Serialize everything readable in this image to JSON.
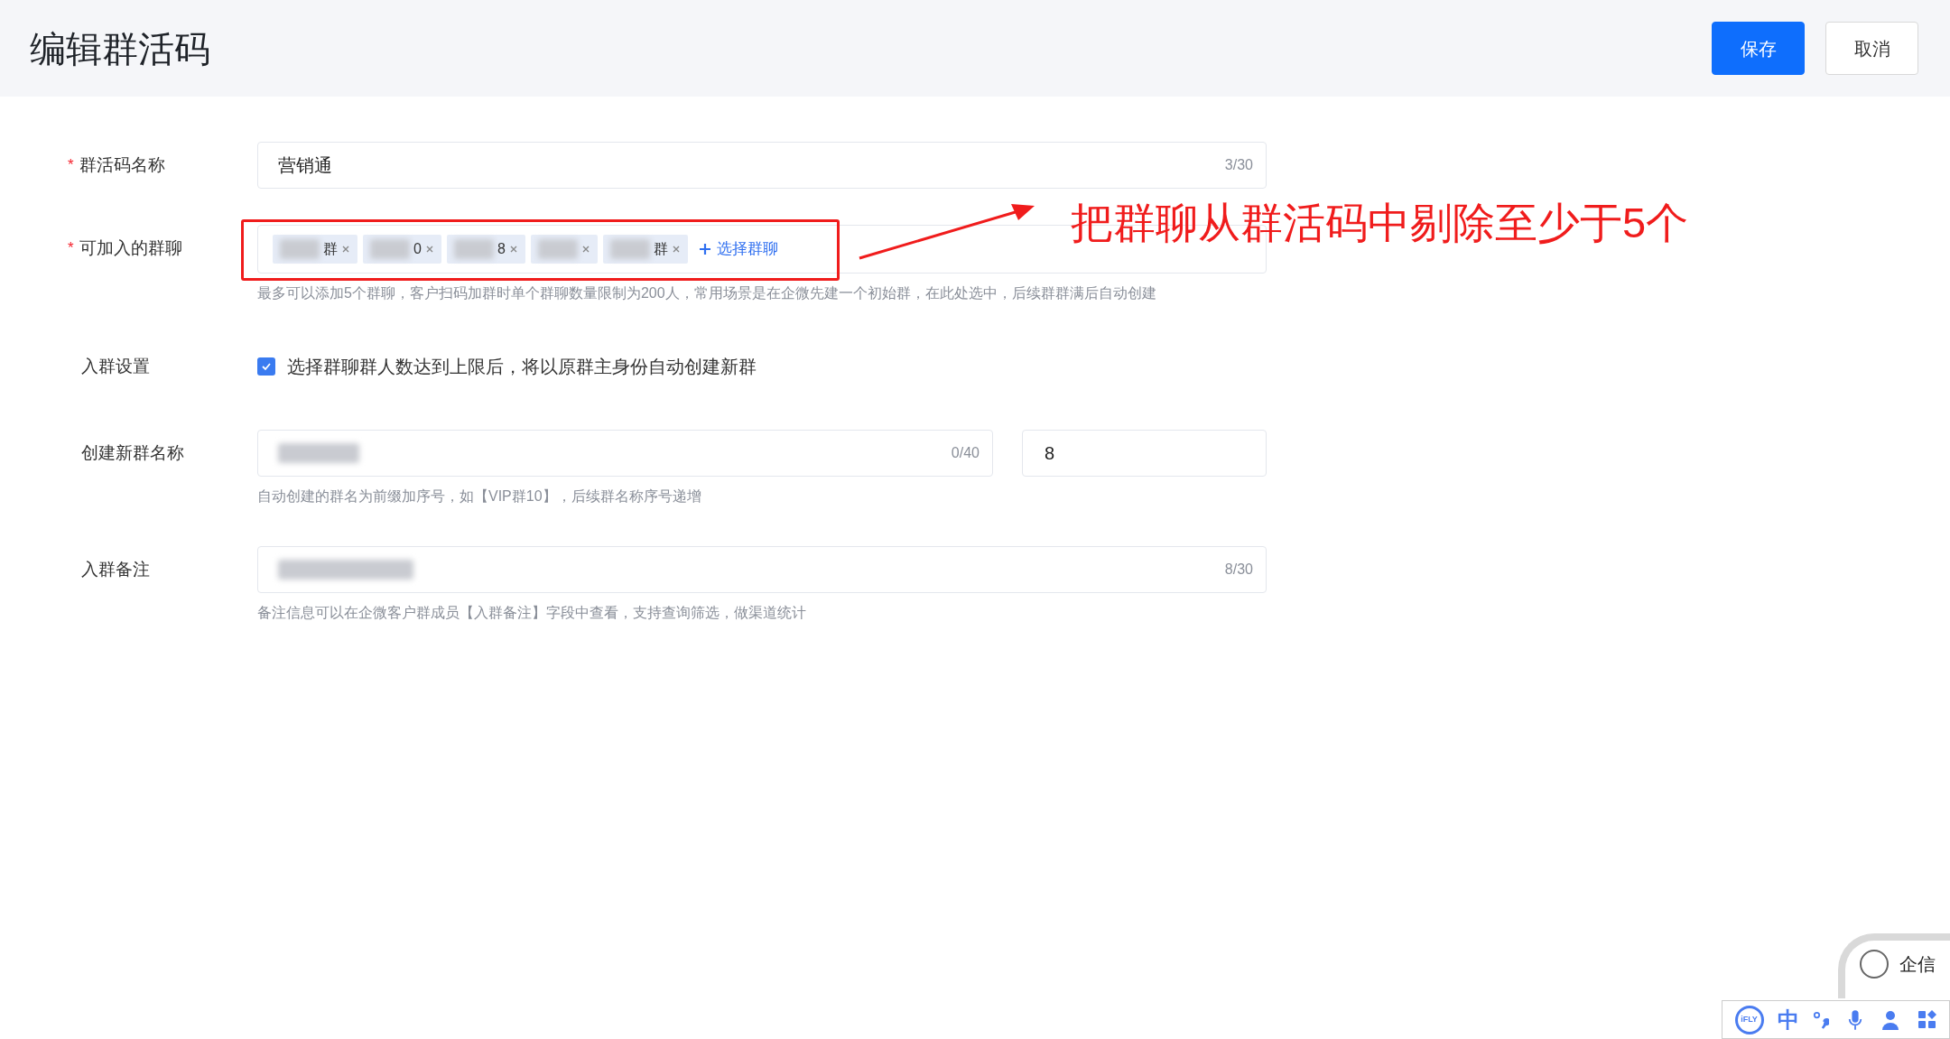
{
  "header": {
    "title": "编辑群活码",
    "buttons": [
      {
        "label": "保存",
        "kind": "primary"
      },
      {
        "label": "取消",
        "kind": "default"
      }
    ]
  },
  "form": {
    "rows": [
      {
        "kind": "text",
        "label": "群活码名称",
        "required_mark": "*",
        "value": "营销通",
        "counter": "3/30"
      },
      {
        "kind": "tags",
        "label": "可加入的群聊",
        "required_mark": "*",
        "tags": [
          {
            "kind": "blurred_suffix",
            "text": "群"
          },
          {
            "kind": "blurred_suffix",
            "text": "0"
          },
          {
            "kind": "blurred_suffix",
            "text": "8"
          },
          {
            "kind": "blurred"
          },
          {
            "kind": "blurred_suffix",
            "text": "群"
          }
        ],
        "add_label": "选择群聊",
        "hint": "最多可以添加5个群聊，客户扫码加群时单个群聊数量限制为200人，常用场景是在企微先建一个初始群，在此处选中，后续群群满后自动创建"
      },
      {
        "kind": "checkbox",
        "label": "入群设置",
        "checked": true,
        "text": "选择群聊群人数达到上限后，将以原群主身份自动创建新群"
      },
      {
        "kind": "text_pair",
        "label": "创建新群名称",
        "counter": "0/40",
        "second_value": "8",
        "hint": "自动创建的群名为前缀加序号，如【VIP群10】，后续群名称序号递增"
      },
      {
        "kind": "text",
        "label": "入群备注",
        "counter": "8/30",
        "hint": "备注信息可以在企微客户群成员【入群备注】字段中查看，支持查询筛选，做渠道统计"
      }
    ]
  },
  "annotation": {
    "text": "把群聊从群活码中剔除至少于5个"
  },
  "widget": {
    "text": "企信"
  },
  "ime_toolbar": {
    "logo": "iFLY",
    "mode": "中"
  }
}
